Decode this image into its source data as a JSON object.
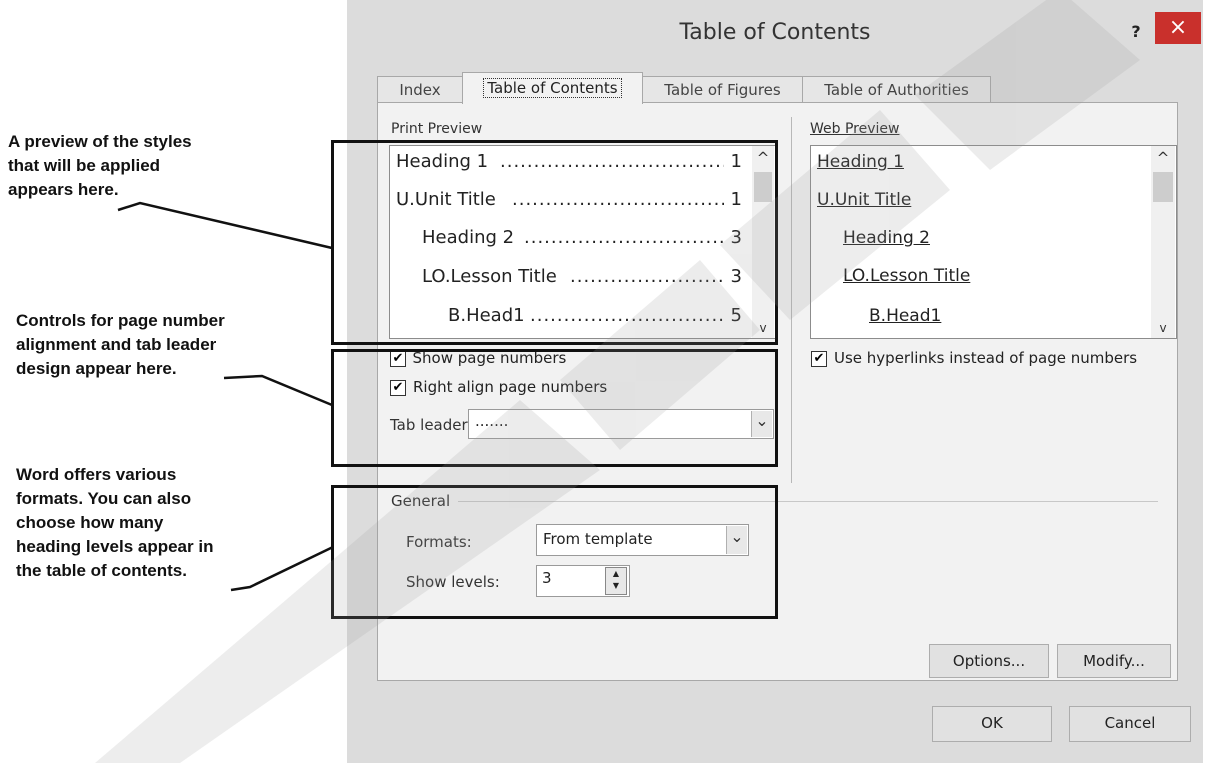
{
  "callouts": [
    [
      "A preview of the styles",
      "that will be applied",
      "appears here."
    ],
    [
      "Controls for page number",
      "alignment and tab leader",
      "design appear here."
    ],
    [
      "Word offers various",
      "formats. You can also",
      "choose how many",
      "heading levels appear in",
      "the table of contents."
    ]
  ],
  "dialog": {
    "title": "Table of Contents",
    "help": "?",
    "close": "×"
  },
  "tabs": [
    {
      "label": "Index"
    },
    {
      "label": "Table of Contents",
      "active": true
    },
    {
      "label": "Table of Figures"
    },
    {
      "label": "Table of Authorities"
    }
  ],
  "print_preview": {
    "label": "Print Preview",
    "entries": [
      {
        "text": "Heading 1",
        "page": "1"
      },
      {
        "text": "U.Unit Title",
        "page": "1"
      },
      {
        "text": "Heading 2",
        "page": "3"
      },
      {
        "text": "LO.Lesson Title",
        "page": "3"
      },
      {
        "text": "B.Head1",
        "page": "5"
      }
    ]
  },
  "web_preview": {
    "label": "Web Preview",
    "entries": [
      "Heading 1",
      "U.Unit Title",
      "Heading 2",
      "LO.Lesson Title",
      "B.Head1"
    ]
  },
  "options": {
    "show_page_numbers": {
      "label": "Show page numbers",
      "checked": true
    },
    "right_align": {
      "label": "Right align page numbers",
      "checked": true
    },
    "hyperlinks": {
      "label": "Use hyperlinks instead of page numbers",
      "checked": true
    },
    "tab_leader": {
      "label": "Tab leader:",
      "value": "......."
    }
  },
  "general": {
    "label": "General",
    "formats_label": "Formats:",
    "formats_value": "From template",
    "levels_label": "Show levels:",
    "levels_value": "3"
  },
  "buttons": {
    "options": "Options...",
    "modify": "Modify...",
    "ok": "OK",
    "cancel": "Cancel"
  },
  "glyphs": {
    "check": "✔",
    "scroll_up": "^",
    "scroll_down": "v",
    "combo_arrow": "⌄",
    "spin_up": "▲",
    "spin_down": "▼"
  }
}
